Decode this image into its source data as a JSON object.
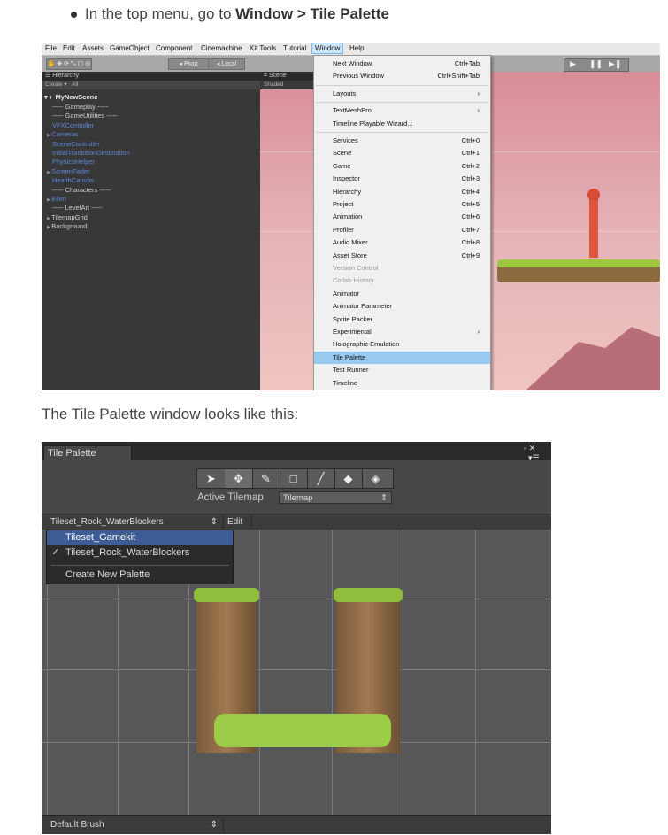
{
  "bullet": {
    "prefix": "In the top menu, go to ",
    "bold": "Window > Tile Palette"
  },
  "caption": "The Tile Palette window looks like this:",
  "unity_editor": {
    "menubar": [
      "File",
      "Edit",
      "Assets",
      "GameObject",
      "Component",
      "Cinemachine",
      "Kit Tools",
      "Tutorial",
      "Window",
      "Help"
    ],
    "toolbar": {
      "pivot": "Pivot",
      "local": "Local"
    },
    "hierarchy": {
      "title": "Hierarchy",
      "create": "Create",
      "search": "All",
      "scene": "MyNewScene",
      "items": [
        {
          "label": "----- Gameplay -----",
          "color": "#cfcfcf",
          "arrow": false
        },
        {
          "label": "----- GameUtilities -----",
          "color": "#cfcfcf",
          "arrow": false
        },
        {
          "label": "VFXController",
          "color": "#5e86d8",
          "arrow": false
        },
        {
          "label": "Cameras",
          "color": "#5e86d8",
          "arrow": true
        },
        {
          "label": "SceneController",
          "color": "#5e86d8",
          "arrow": false
        },
        {
          "label": "InitialTransitionDestination",
          "color": "#5e86d8",
          "arrow": false
        },
        {
          "label": "PhysicsHelper",
          "color": "#5e86d8",
          "arrow": false
        },
        {
          "label": "ScreenFader",
          "color": "#5e86d8",
          "arrow": true
        },
        {
          "label": "HealthCanvas",
          "color": "#5e86d8",
          "arrow": false
        },
        {
          "label": "----- Characters -----",
          "color": "#cfcfcf",
          "arrow": false
        },
        {
          "label": "Ellen",
          "color": "#5e86d8",
          "arrow": true
        },
        {
          "label": "----- LevelArt -----",
          "color": "#cfcfcf",
          "arrow": false
        },
        {
          "label": "TilemapGrid",
          "color": "#cfcfcf",
          "arrow": true
        },
        {
          "label": "Background",
          "color": "#cfcfcf",
          "arrow": true
        }
      ]
    },
    "scene_view": {
      "tab": "Scene",
      "mode": "Shaded"
    },
    "window_menu": [
      {
        "label": "Next Window",
        "shortcut": "Ctrl+Tab"
      },
      {
        "label": "Previous Window",
        "shortcut": "Ctrl+Shift+Tab"
      },
      {
        "sep": true
      },
      {
        "label": "Layouts",
        "shortcut": "›"
      },
      {
        "sep": true
      },
      {
        "label": "TextMeshPro",
        "shortcut": "›"
      },
      {
        "label": "Timeline Playable Wizard...",
        "shortcut": ""
      },
      {
        "sep": true
      },
      {
        "label": "Services",
        "shortcut": "Ctrl+0"
      },
      {
        "label": "Scene",
        "shortcut": "Ctrl+1"
      },
      {
        "label": "Game",
        "shortcut": "Ctrl+2"
      },
      {
        "label": "Inspector",
        "shortcut": "Ctrl+3"
      },
      {
        "label": "Hierarchy",
        "shortcut": "Ctrl+4"
      },
      {
        "label": "Project",
        "shortcut": "Ctrl+5"
      },
      {
        "label": "Animation",
        "shortcut": "Ctrl+6"
      },
      {
        "label": "Profiler",
        "shortcut": "Ctrl+7"
      },
      {
        "label": "Audio Mixer",
        "shortcut": "Ctrl+8"
      },
      {
        "label": "Asset Store",
        "shortcut": "Ctrl+9"
      },
      {
        "label": "Version Control",
        "shortcut": "",
        "disabled": true
      },
      {
        "label": "Collab History",
        "shortcut": "",
        "disabled": true
      },
      {
        "label": "Animator",
        "shortcut": ""
      },
      {
        "label": "Animator Parameter",
        "shortcut": ""
      },
      {
        "label": "Sprite Packer",
        "shortcut": ""
      },
      {
        "label": "Experimental",
        "shortcut": "›"
      },
      {
        "label": "Holographic Emulation",
        "shortcut": ""
      },
      {
        "label": "Tile Palette",
        "shortcut": "",
        "highlighted": true
      },
      {
        "label": "Test Runner",
        "shortcut": ""
      },
      {
        "label": "Timeline",
        "shortcut": ""
      }
    ]
  },
  "tile_palette": {
    "tab": "Tile Palette",
    "active_tilemap_label": "Active Tilemap",
    "active_tilemap_value": "Tilemap",
    "palette_selected": "Tileset_Rock_WaterBlockers",
    "edit": "Edit",
    "dropdown": {
      "items": [
        {
          "label": "Tileset_Gamekit",
          "highlighted": true,
          "checked": false
        },
        {
          "label": "Tileset_Rock_WaterBlockers",
          "highlighted": false,
          "checked": true
        }
      ],
      "create": "Create New Palette"
    },
    "brush": "Default Brush",
    "tools": [
      "select-icon",
      "move-icon",
      "paint-brush-icon",
      "box-fill-icon",
      "picker-icon",
      "eraser-icon",
      "fill-icon"
    ]
  }
}
